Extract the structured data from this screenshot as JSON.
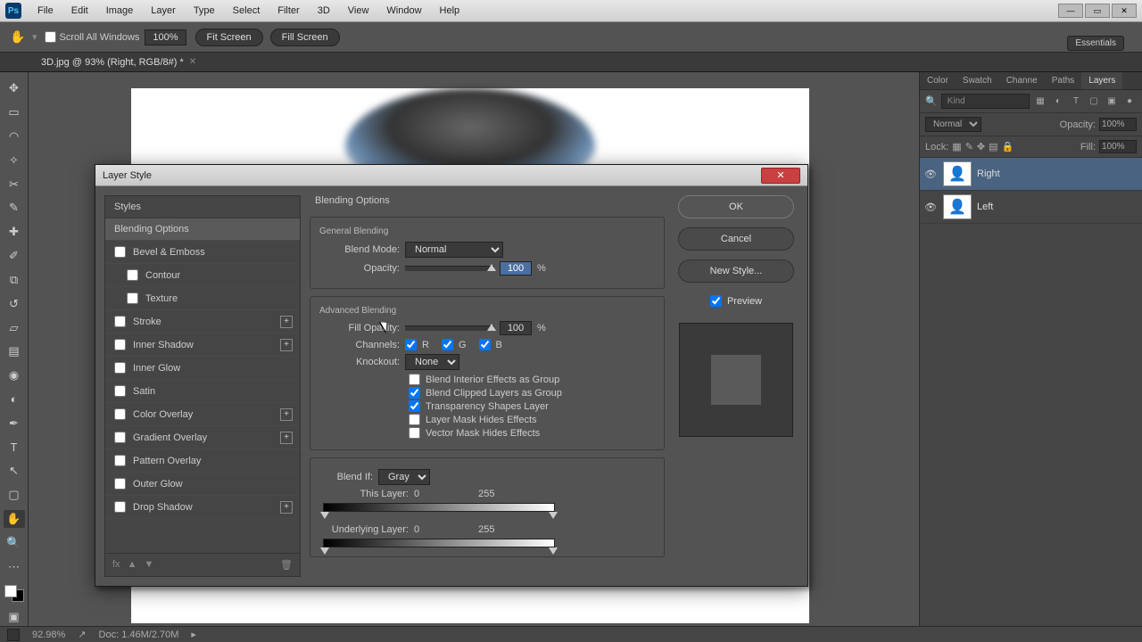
{
  "menubar": {
    "items": [
      "File",
      "Edit",
      "Image",
      "Layer",
      "Type",
      "Select",
      "Filter",
      "3D",
      "View",
      "Window",
      "Help"
    ],
    "ps": "Ps"
  },
  "options": {
    "scroll_all_label": "Scroll All Windows",
    "zoom": "100%",
    "fit_screen": "Fit Screen",
    "fill_screen": "Fill Screen",
    "essentials": "Essentials"
  },
  "doc_tab": {
    "title": "3D.jpg @ 93% (Right, RGB/8#) *"
  },
  "panels": {
    "tabs": [
      "Color",
      "Swatch",
      "Channe",
      "Paths",
      "Layers"
    ],
    "kind_placeholder": "Kind",
    "blend_mode": "Normal",
    "opacity_label": "Opacity:",
    "opacity_val": "100%",
    "lock_label": "Lock:",
    "fill_label": "Fill:",
    "fill_val": "100%",
    "layers": [
      {
        "name": "Right",
        "selected": true
      },
      {
        "name": "Left",
        "selected": false
      }
    ]
  },
  "status": {
    "zoom": "92.98%",
    "doc": "Doc: 1.46M/2.70M"
  },
  "dialog": {
    "title": "Layer Style",
    "styles_header": "Styles",
    "effects": [
      {
        "label": "Blending Options",
        "selected": true,
        "check": false
      },
      {
        "label": "Bevel & Emboss",
        "check": true
      },
      {
        "label": "Contour",
        "check": true,
        "indent": true
      },
      {
        "label": "Texture",
        "check": true,
        "indent": true
      },
      {
        "label": "Stroke",
        "check": true,
        "plus": true
      },
      {
        "label": "Inner Shadow",
        "check": true,
        "plus": true
      },
      {
        "label": "Inner Glow",
        "check": true
      },
      {
        "label": "Satin",
        "check": true
      },
      {
        "label": "Color Overlay",
        "check": true,
        "plus": true
      },
      {
        "label": "Gradient Overlay",
        "check": true,
        "plus": true
      },
      {
        "label": "Pattern Overlay",
        "check": true
      },
      {
        "label": "Outer Glow",
        "check": true
      },
      {
        "label": "Drop Shadow",
        "check": true,
        "plus": true
      }
    ],
    "content": {
      "title": "Blending Options",
      "general": "General Blending",
      "blend_mode_label": "Blend Mode:",
      "blend_mode": "Normal",
      "opacity_label": "Opacity:",
      "opacity_val": "100",
      "pct": "%",
      "advanced": "Advanced Blending",
      "fill_opacity_label": "Fill Opacity:",
      "fill_opacity_val": "100",
      "channels_label": "Channels:",
      "ch_r": "R",
      "ch_g": "G",
      "ch_b": "B",
      "knockout_label": "Knockout:",
      "knockout": "None",
      "blend_interior": "Blend Interior Effects as Group",
      "blend_clipped": "Blend Clipped Layers as Group",
      "transparency_shapes": "Transparency Shapes Layer",
      "layer_mask_hides": "Layer Mask Hides Effects",
      "vector_mask_hides": "Vector Mask Hides Effects",
      "blend_if_label": "Blend If:",
      "blend_if": "Gray",
      "this_layer_label": "This Layer:",
      "this_low": "0",
      "this_high": "255",
      "under_label": "Underlying Layer:",
      "under_low": "0",
      "under_high": "255"
    },
    "buttons": {
      "ok": "OK",
      "cancel": "Cancel",
      "new_style": "New Style...",
      "preview": "Preview"
    }
  }
}
